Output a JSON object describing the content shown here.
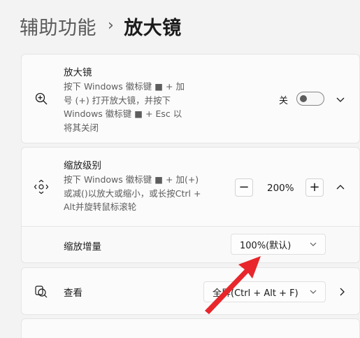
{
  "breadcrumb": {
    "parent": "辅助功能",
    "separator": "›",
    "current": "放大镜"
  },
  "magnifier": {
    "icon": "zoom-in-icon",
    "title": "放大镜",
    "desc_lines": [
      "按下 Windows 徽标键 ■ + 加",
      "号 (+) 打开放大镜，并按下",
      "Windows 徽标键 ■ + Esc 以",
      "将其关闭"
    ],
    "toggle_label": "关",
    "toggle_on": false
  },
  "zoom_level": {
    "icon": "move-arrows-icon",
    "title": "缩放级别",
    "desc_lines": [
      "按下 Windows 徽标键 ■ + 加(+)",
      "或减()以放大或缩小，或长按Ctrl +",
      "Alt并旋转鼠标滚轮"
    ],
    "minus": "−",
    "value": "200%",
    "plus": "+"
  },
  "zoom_increment": {
    "label": "缩放增量",
    "selected": "100%(默认)"
  },
  "view": {
    "icon": "view-icon",
    "label": "查看",
    "selected": "全屏(Ctrl + Alt + F)"
  },
  "colors": {
    "background": "#f3f3f3",
    "card": "#fbfbfb",
    "annotation_arrow": "#e8262b"
  }
}
